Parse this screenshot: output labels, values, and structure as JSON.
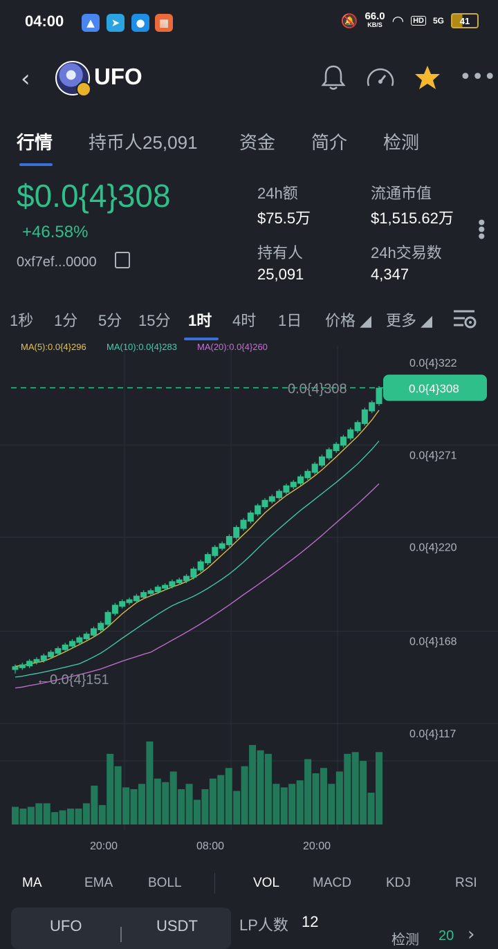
{
  "status_bar": {
    "time": "04:00",
    "net_speed": "66.0",
    "net_unit": "KB/S",
    "hd": "HD",
    "signal": "5G",
    "battery": "41"
  },
  "header": {
    "title": "UFO",
    "icons": [
      "back-icon",
      "bell-icon",
      "speedometer-icon",
      "star-icon",
      "more-icon"
    ]
  },
  "tabs": [
    "行情",
    "持币人25,091",
    "资金",
    "简介",
    "检测"
  ],
  "summary": {
    "price": "$0.0{4}308",
    "change": "+46.58%",
    "address": "0xf7ef...0000",
    "stats": [
      {
        "label": "24h额",
        "value": "$75.5万"
      },
      {
        "label": "流通市值",
        "value": "$1,515.62万"
      },
      {
        "label": "持有人",
        "value": "25,091"
      },
      {
        "label": "24h交易数",
        "value": "4,347"
      }
    ]
  },
  "timeframes": [
    "1秒",
    "1分",
    "5分",
    "15分",
    "1时",
    "4时",
    "1日",
    "价格 ◢",
    "更多 ◢"
  ],
  "timeframe_active": "1时",
  "ma_legend": {
    "ma5": "MA(5):0.0{4}296",
    "ma10": "MA(10):0.0{4}283",
    "ma20": "MA(20):0.0{4}260"
  },
  "colors": {
    "up": "#2fbf8a",
    "ma5": "#e8c14a",
    "ma10": "#3fd1b0",
    "ma20": "#c86fd6",
    "accent": "#3b6fd9"
  },
  "chart_data": {
    "type": "candlestick",
    "y_ticks": [
      "0.0{4}322",
      "0.0{4}271",
      "0.0{4}220",
      "0.0{4}168",
      "0.0{4}117"
    ],
    "x_ticks": [
      "20:00",
      "08:00",
      "20:00"
    ],
    "current_price_label": "0.0{4}308",
    "max_label": "0.0{4}308",
    "min_label": "0.0{4}151",
    "ylim": [
      117,
      322
    ],
    "unit": "0.0{4}",
    "candles": [
      [
        152,
        154,
        150,
        155
      ],
      [
        153,
        155,
        152,
        156
      ],
      [
        154,
        157,
        153,
        158
      ],
      [
        156,
        158,
        155,
        159
      ],
      [
        157,
        160,
        156,
        161
      ],
      [
        159,
        162,
        158,
        163
      ],
      [
        161,
        164,
        160,
        165
      ],
      [
        163,
        166,
        162,
        167
      ],
      [
        165,
        168,
        164,
        169
      ],
      [
        167,
        170,
        166,
        171
      ],
      [
        169,
        172,
        168,
        173
      ],
      [
        171,
        175,
        170,
        176
      ],
      [
        174,
        178,
        173,
        179
      ],
      [
        177,
        184,
        176,
        185
      ],
      [
        183,
        188,
        182,
        189
      ],
      [
        187,
        190,
        186,
        191
      ],
      [
        189,
        191,
        188,
        192
      ],
      [
        190,
        193,
        189,
        194
      ],
      [
        192,
        195,
        191,
        196
      ],
      [
        194,
        196,
        193,
        197
      ],
      [
        195,
        198,
        194,
        199
      ],
      [
        197,
        199,
        196,
        200
      ],
      [
        198,
        201,
        197,
        202
      ],
      [
        200,
        202,
        199,
        203
      ],
      [
        201,
        204,
        200,
        205
      ],
      [
        203,
        208,
        202,
        209
      ],
      [
        207,
        212,
        206,
        213
      ],
      [
        211,
        216,
        210,
        217
      ],
      [
        215,
        220,
        214,
        221
      ],
      [
        219,
        222,
        218,
        223
      ],
      [
        221,
        226,
        220,
        227
      ],
      [
        225,
        231,
        224,
        232
      ],
      [
        230,
        235,
        229,
        236
      ],
      [
        234,
        239,
        233,
        240
      ],
      [
        238,
        243,
        237,
        244
      ],
      [
        242,
        246,
        241,
        247
      ],
      [
        245,
        248,
        244,
        249
      ],
      [
        247,
        251,
        246,
        252
      ],
      [
        250,
        254,
        249,
        255
      ],
      [
        253,
        256,
        252,
        257
      ],
      [
        255,
        259,
        254,
        260
      ],
      [
        258,
        262,
        257,
        263
      ],
      [
        261,
        266,
        260,
        267
      ],
      [
        265,
        270,
        264,
        271
      ],
      [
        269,
        274,
        268,
        275
      ],
      [
        273,
        277,
        272,
        278
      ],
      [
        276,
        281,
        275,
        282
      ],
      [
        280,
        285,
        279,
        286
      ],
      [
        284,
        289,
        283,
        290
      ],
      [
        288,
        296,
        287,
        297
      ],
      [
        295,
        300,
        294,
        301
      ],
      [
        299,
        308,
        298,
        309
      ]
    ],
    "volume": [
      10,
      9,
      10,
      12,
      12,
      7,
      8,
      9,
      9,
      12,
      22,
      11,
      40,
      33,
      21,
      20,
      23,
      47,
      26,
      24,
      30,
      20,
      23,
      14,
      20,
      26,
      28,
      32,
      19,
      33,
      45,
      42,
      40,
      23,
      21,
      23,
      25,
      37,
      29,
      32,
      23,
      30,
      40,
      41,
      36,
      18,
      41
    ]
  },
  "indicators": [
    "MA",
    "EMA",
    "BOLL",
    "VOL",
    "MACD",
    "KDJ",
    "RSI"
  ],
  "indicators_active": [
    "MA",
    "VOL"
  ],
  "pair": {
    "base": "UFO",
    "quote": "USDT",
    "lp_label": "LP人数",
    "lp_value": "12",
    "detect_label": "检测",
    "detect_value": "20"
  }
}
